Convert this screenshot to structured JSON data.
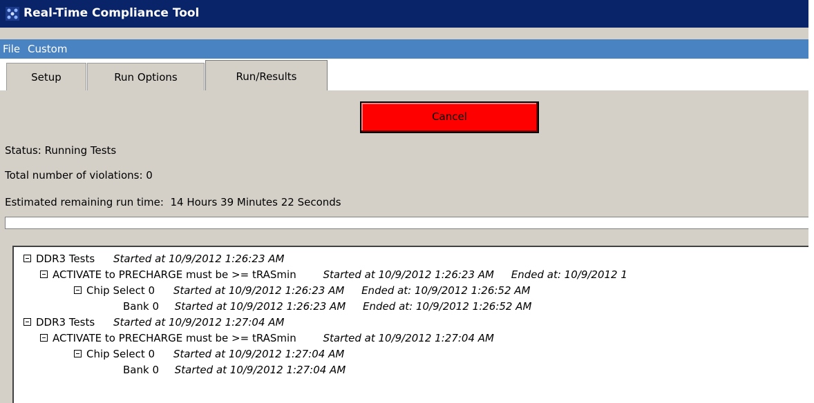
{
  "window": {
    "title": "Real-Time Compliance Tool",
    "title_bar_color": "#0a246a",
    "menu_bar_color": "#4a83c2"
  },
  "menu": {
    "items": [
      "File",
      "Custom"
    ]
  },
  "tabs": [
    {
      "label": "Setup",
      "active": false
    },
    {
      "label": "Run Options",
      "active": false
    },
    {
      "label": "Run/Results",
      "active": true
    }
  ],
  "run": {
    "cancel_label": "Cancel",
    "cancel_color": "#ff0000",
    "status": "Status: Running Tests",
    "violations": "Total number of violations: 0",
    "remaining": "Estimated remaining run time:  14 Hours 39 Minutes 22 Seconds",
    "progress_fraction": 0.0
  },
  "tree": [
    {
      "label": "DDR3 Tests",
      "start": "Started at 10/9/2012 1:26:23 AM",
      "end": "",
      "expander": "minus-icon"
    },
    {
      "label": "ACTIVATE to PRECHARGE must be >= tRASmin",
      "start": "Started at 10/9/2012 1:26:23 AM",
      "end": "Ended at: 10/9/2012 1",
      "expander": "minus-icon"
    },
    {
      "label": "Chip Select 0",
      "start": "Started at 10/9/2012 1:26:23 AM",
      "end": "Ended at: 10/9/2012 1:26:52 AM",
      "expander": "minus-icon"
    },
    {
      "label": "Bank 0",
      "start": "Started at 10/9/2012 1:26:23 AM",
      "end": "Ended at: 10/9/2012 1:26:52 AM",
      "expander": ""
    },
    {
      "label": "DDR3 Tests",
      "start": "Started at 10/9/2012 1:27:04 AM",
      "end": "",
      "expander": "minus-icon"
    },
    {
      "label": "ACTIVATE to PRECHARGE must be >= tRASmin",
      "start": "Started at 10/9/2012 1:27:04 AM",
      "end": "",
      "expander": "minus-icon"
    },
    {
      "label": "Chip Select 0",
      "start": "Started at 10/9/2012 1:27:04 AM",
      "end": "",
      "expander": "minus-icon"
    },
    {
      "label": "Bank 0",
      "start": "Started at 10/9/2012 1:27:04 AM",
      "end": "",
      "expander": ""
    }
  ]
}
